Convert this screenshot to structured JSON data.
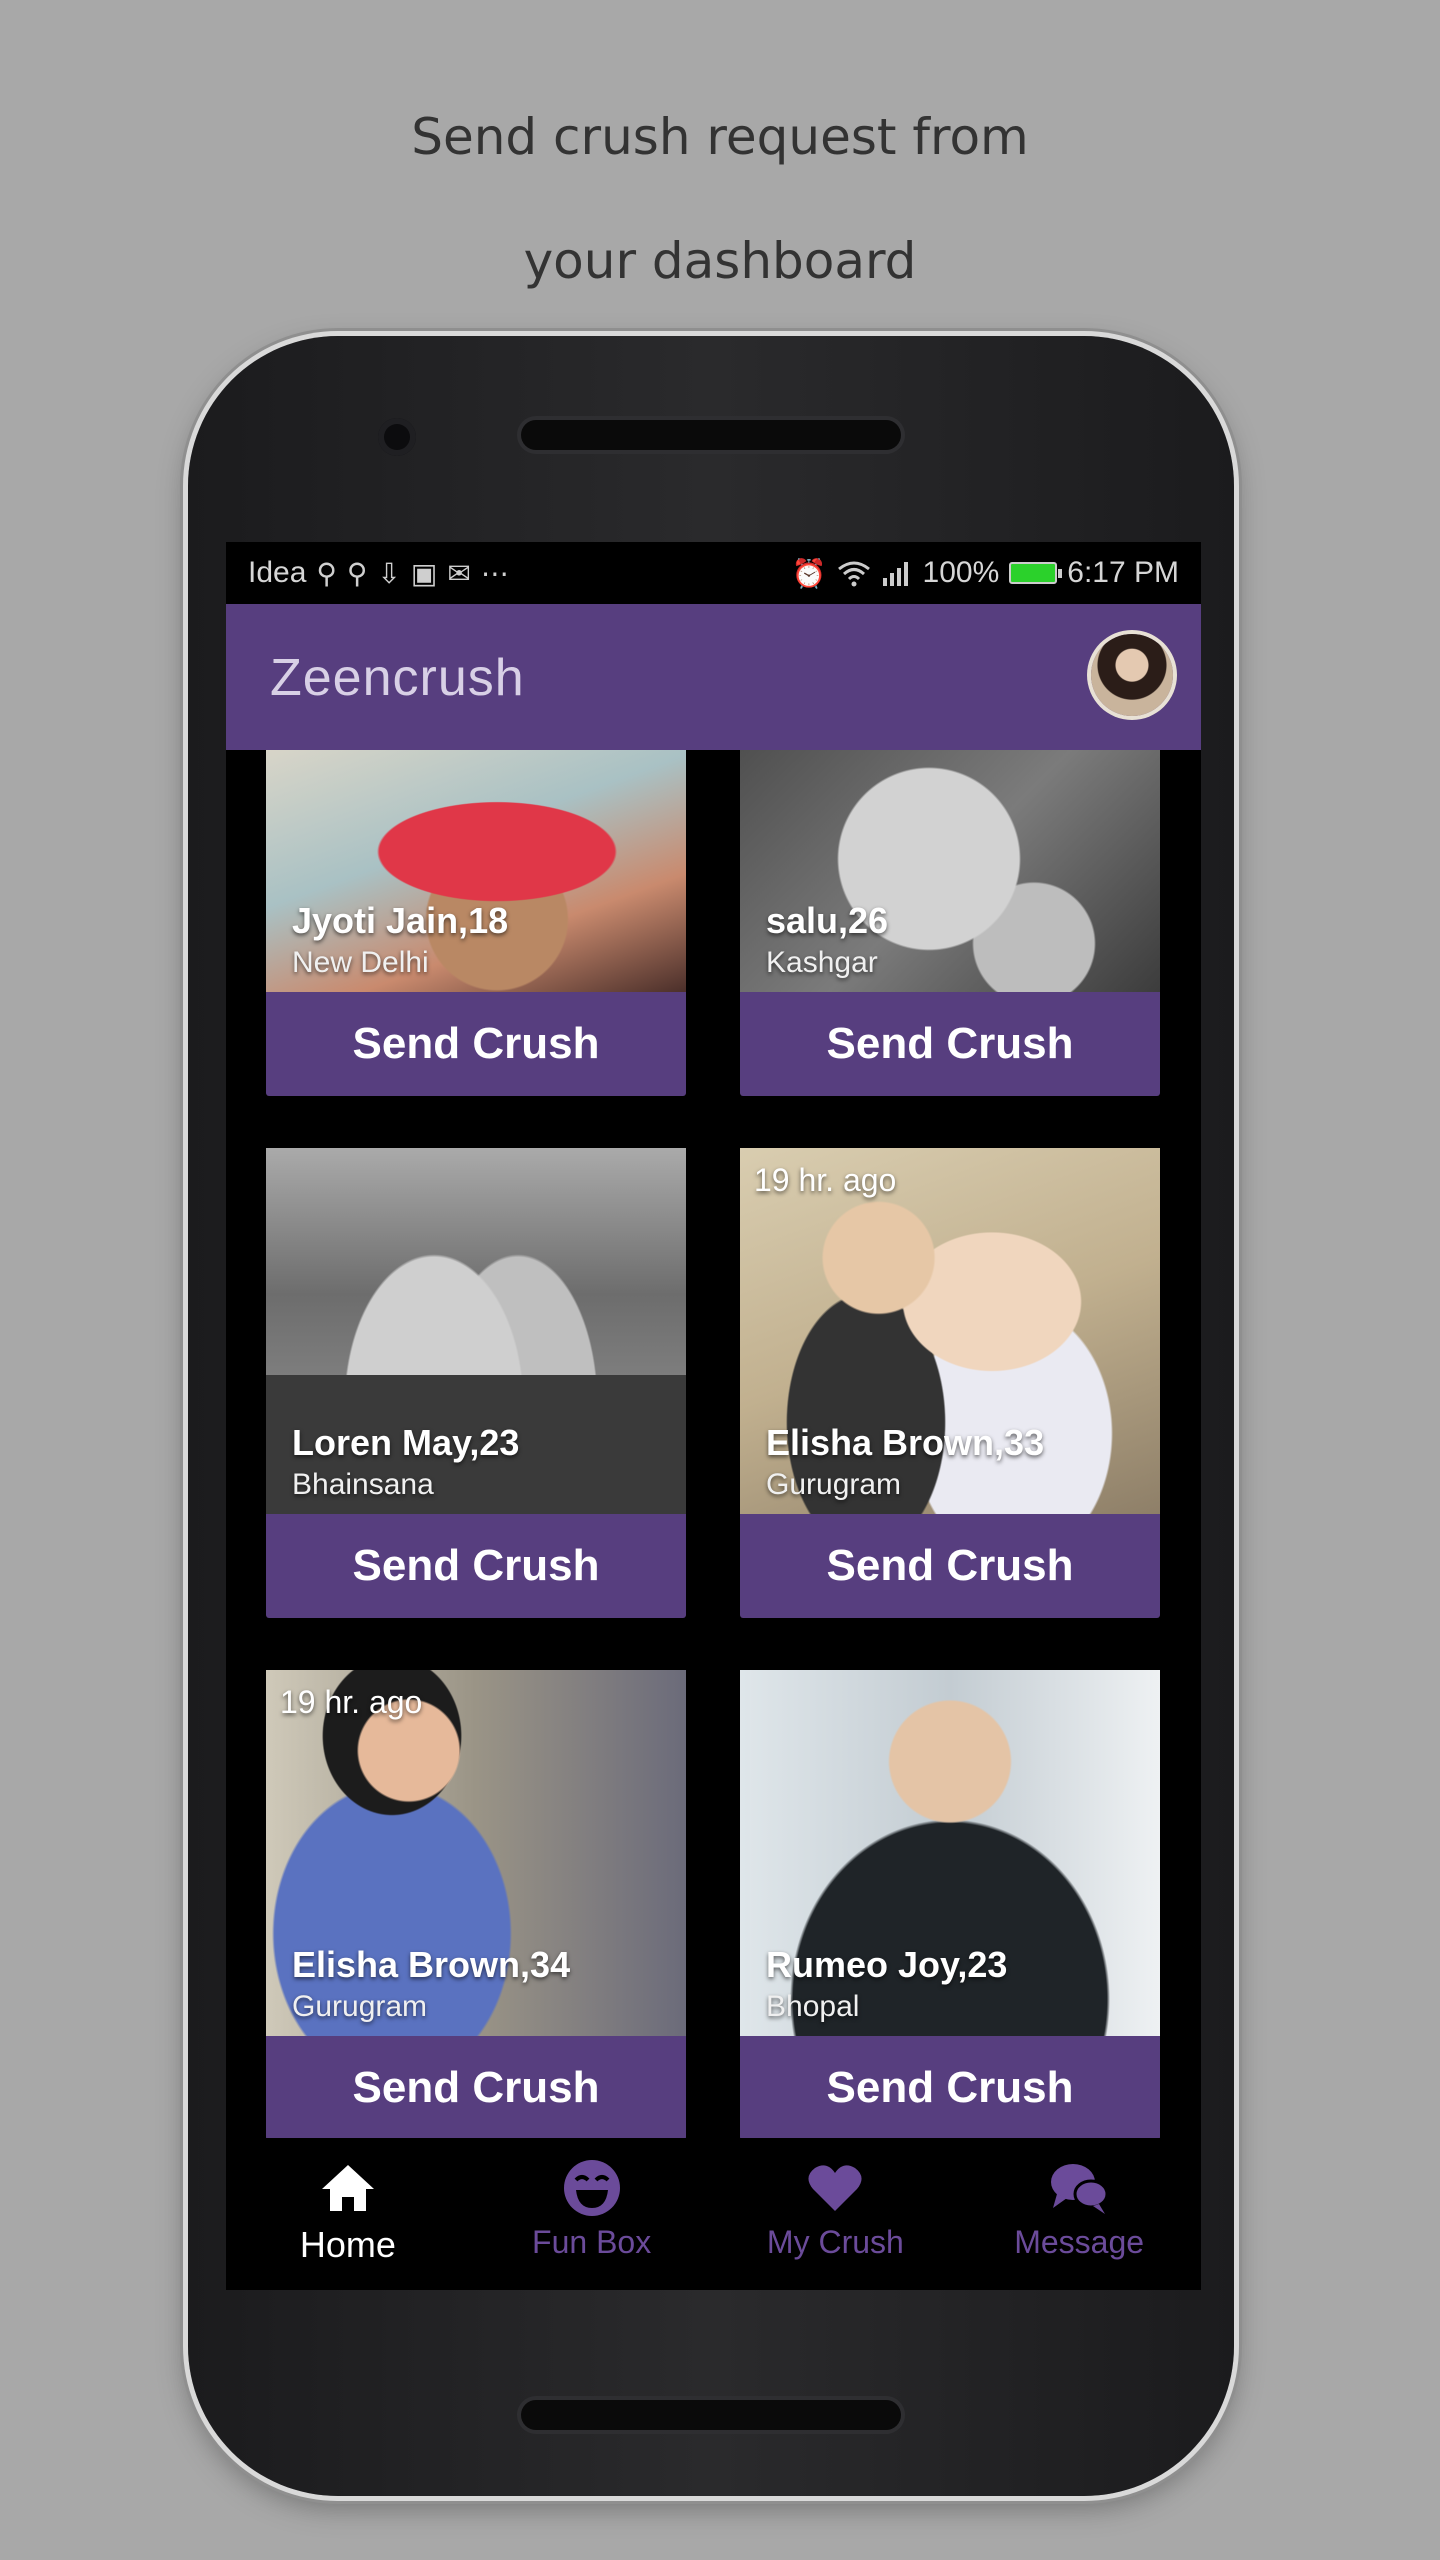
{
  "caption": {
    "line1": "Send crush request from",
    "line2": "your dashboard"
  },
  "statusbar": {
    "carrier": "Idea",
    "left_icons": [
      "usb-icon",
      "usb-icon",
      "download-icon",
      "paytm-icon",
      "mail-icon",
      "more-icon"
    ],
    "right_icons": [
      "alarm-icon",
      "wifi-icon",
      "signal-icon"
    ],
    "battery_percent": "100%",
    "time": "6:17 PM"
  },
  "appbar": {
    "title": "Zeencrush"
  },
  "cards": [
    {
      "name": "Jyoti Jain,18",
      "city": "New Delhi",
      "ago": "",
      "button": "Send Crush"
    },
    {
      "name": "salu,26",
      "city": "Kashgar",
      "ago": "",
      "button": "Send Crush"
    },
    {
      "name": "Loren May,23",
      "city": "Bhainsana",
      "ago": "",
      "button": "Send Crush"
    },
    {
      "name": "Elisha Brown,33",
      "city": "Gurugram",
      "ago": "19 hr. ago",
      "button": "Send Crush"
    },
    {
      "name": "Elisha Brown,34",
      "city": "Gurugram",
      "ago": "19 hr. ago",
      "button": "Send Crush"
    },
    {
      "name": "Rumeo Joy,23",
      "city": "Bhopal",
      "ago": "",
      "button": "Send Crush"
    }
  ],
  "bottom_nav": [
    {
      "label": "Home",
      "icon": "home-icon",
      "active": true
    },
    {
      "label": "Fun Box",
      "icon": "laugh-icon",
      "active": false
    },
    {
      "label": "My Crush",
      "icon": "heart-icon",
      "active": false
    },
    {
      "label": "Message",
      "icon": "chat-icon",
      "active": false
    }
  ],
  "colors": {
    "primary": "#573e7f",
    "inactive_nav": "#6b4b9a",
    "background": "#a8a8a8"
  }
}
